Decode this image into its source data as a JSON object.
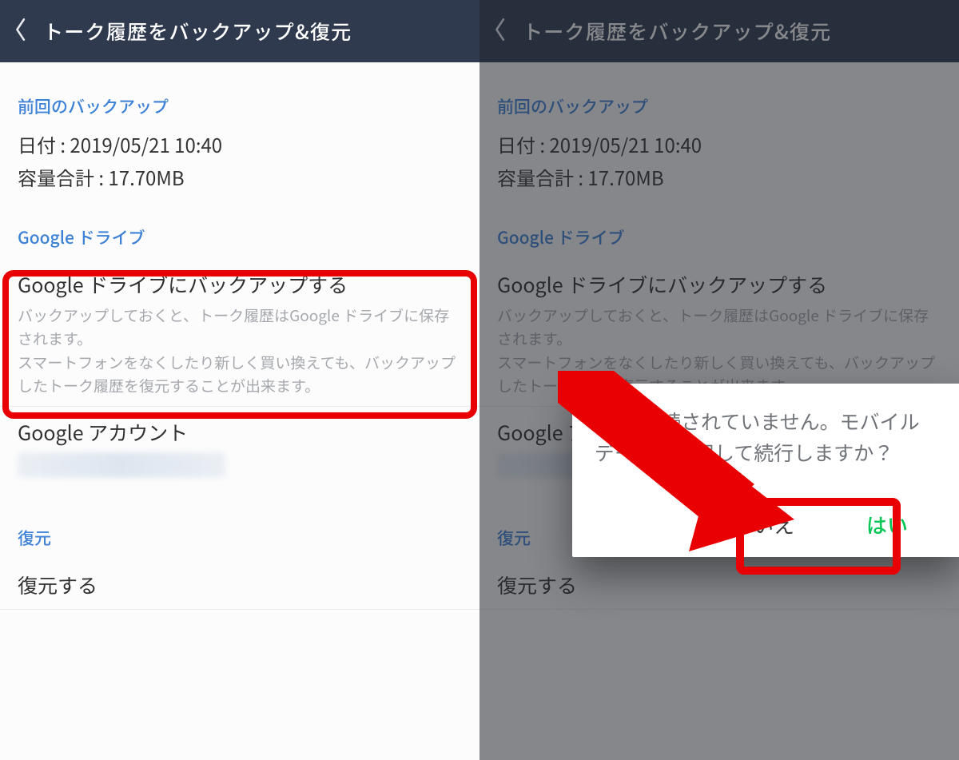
{
  "header": {
    "title": "トーク履歴をバックアップ&復元"
  },
  "last_backup": {
    "label": "前回のバックアップ",
    "date_line": "日付 : 2019/05/21 10:40",
    "size_line": "容量合計 : 17.70MB"
  },
  "gdrive": {
    "label": "Google ドライブ",
    "backup_title": "Google ドライブにバックアップする",
    "backup_desc": "バックアップしておくと、トーク履歴はGoogle ドライブに保存されます。\nスマートフォンをなくしたり新しく買い換えても、バックアップしたトーク履歴を復元することが出来ます。",
    "account_title": "Google アカウント"
  },
  "restore": {
    "label": "復元",
    "action_title": "復元する"
  },
  "dialog": {
    "message": "Wi-Fi接続されていません。モバイルデータを利用して続行しますか？",
    "no": "いいえ",
    "yes": "はい"
  },
  "annotation": {
    "highlight_color": "#e90003",
    "arrow_color": "#e90003"
  }
}
